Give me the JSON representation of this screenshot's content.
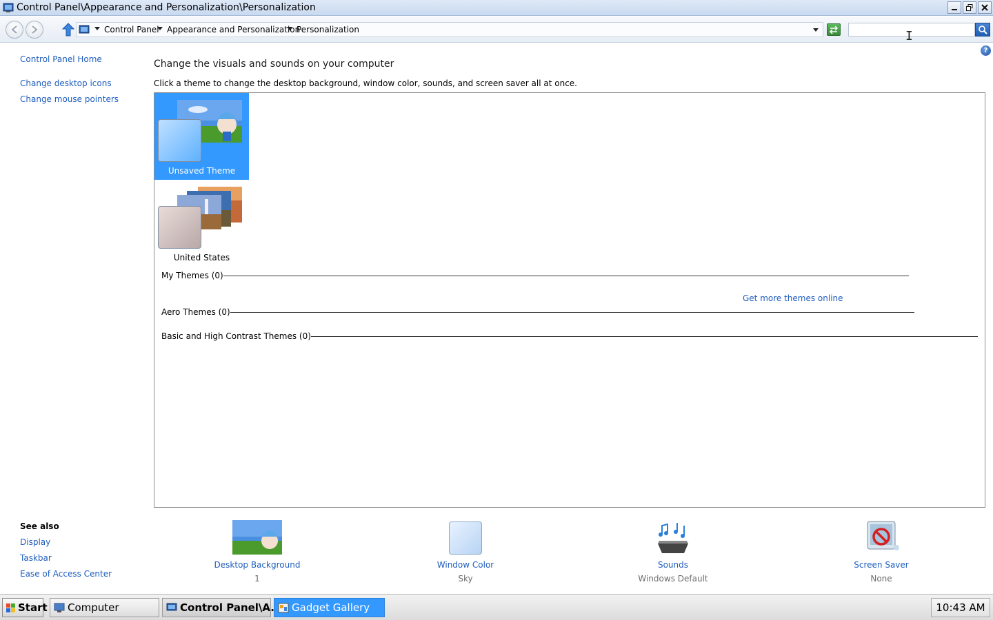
{
  "window": {
    "title": "Control Panel\\Appearance and Personalization\\Personalization",
    "icon": "control-panel-icon"
  },
  "address_bar": {
    "breadcrumbs": [
      "Control Panel",
      "Appearance and Personalization",
      "Personalization"
    ],
    "search_value": ""
  },
  "left_pane": {
    "home": "Control Panel Home",
    "links": [
      "Change desktop icons",
      "Change mouse pointers"
    ],
    "see_also_title": "See also",
    "see_also": [
      "Display",
      "Taskbar",
      "Ease of Access Center"
    ]
  },
  "main": {
    "heading": "Change the visuals and sounds on your computer",
    "description": "Click a theme to change the desktop background, window color, sounds, and screen saver all at once.",
    "themes": [
      {
        "name": "Unsaved Theme",
        "selected": true
      },
      {
        "name": "United States",
        "selected": false
      }
    ],
    "groups": {
      "my_themes": "My Themes (0)",
      "get_more": "Get more themes online",
      "aero": "Aero Themes (0)",
      "basic": "Basic and High Contrast Themes (0)"
    }
  },
  "settings": [
    {
      "label": "Desktop Background",
      "value": "1",
      "icon": "desktop-background-icon"
    },
    {
      "label": "Window Color",
      "value": "Sky",
      "icon": "window-color-icon"
    },
    {
      "label": "Sounds",
      "value": "Windows Default",
      "icon": "sounds-icon"
    },
    {
      "label": "Screen Saver",
      "value": "None",
      "icon": "screen-saver-icon"
    }
  ],
  "taskbar": {
    "start": "Start",
    "tasks": [
      "Computer",
      "Control Panel\\A...",
      "Gadget Gallery"
    ],
    "clock": "10:43 AM"
  },
  "colors": {
    "selection": "#3399ff",
    "link": "#1e5dbd"
  }
}
